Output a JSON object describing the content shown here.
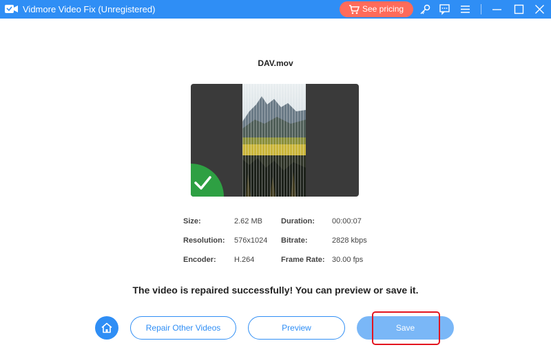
{
  "window": {
    "title": "Vidmore Video Fix (Unregistered)",
    "pricing_label": "See pricing"
  },
  "video": {
    "filename": "DAV.mov"
  },
  "info": {
    "size_label": "Size:",
    "size_value": "2.62 MB",
    "duration_label": "Duration:",
    "duration_value": "00:00:07",
    "resolution_label": "Resolution:",
    "resolution_value": "576x1024",
    "bitrate_label": "Bitrate:",
    "bitrate_value": "2828 kbps",
    "encoder_label": "Encoder:",
    "encoder_value": "H.264",
    "framerate_label": "Frame Rate:",
    "framerate_value": "30.00 fps"
  },
  "message": "The video is repaired successfully! You can preview or save it.",
  "actions": {
    "repair_other_label": "Repair Other Videos",
    "preview_label": "Preview",
    "save_label": "Save"
  },
  "colors": {
    "titlebar": "#2f8ef5",
    "pricing": "#ff6b5a",
    "success": "#2ea043",
    "save": "#7ab7f7",
    "highlight": "#e3141f"
  }
}
